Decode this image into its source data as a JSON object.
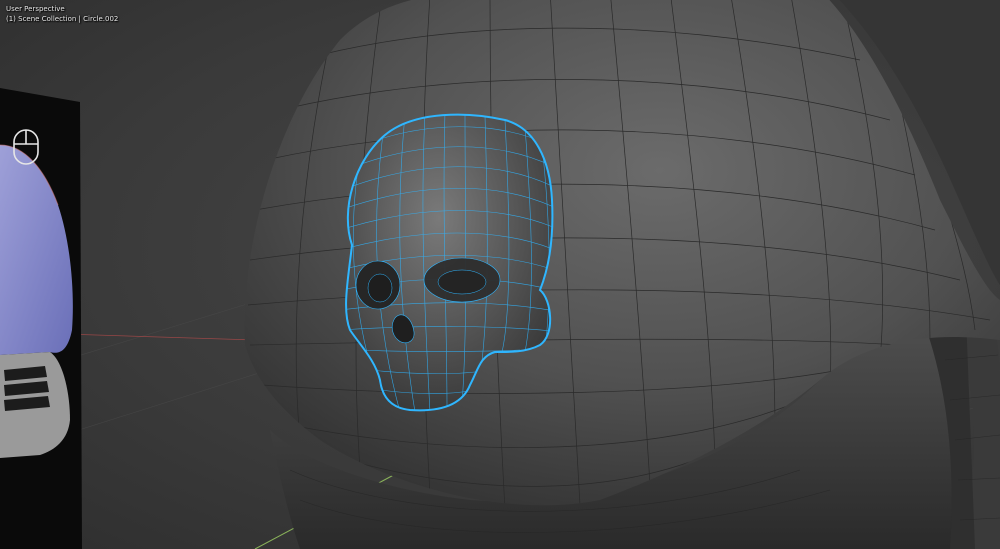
{
  "viewport": {
    "perspective_label": "User Perspective",
    "collection_label": "(1) Scene Collection | Circle.002"
  },
  "icons": {
    "mouse": "mouse-icon"
  },
  "colors": {
    "background": "#3d3d3d",
    "selection_outline": "#2fb6ff",
    "wireframe": "#2a2a2a",
    "x_axis": "#b04a4a",
    "y_axis": "#8ab35a",
    "reference_plane": "#0a0a0a",
    "reference_model": "#8a8fd6"
  }
}
